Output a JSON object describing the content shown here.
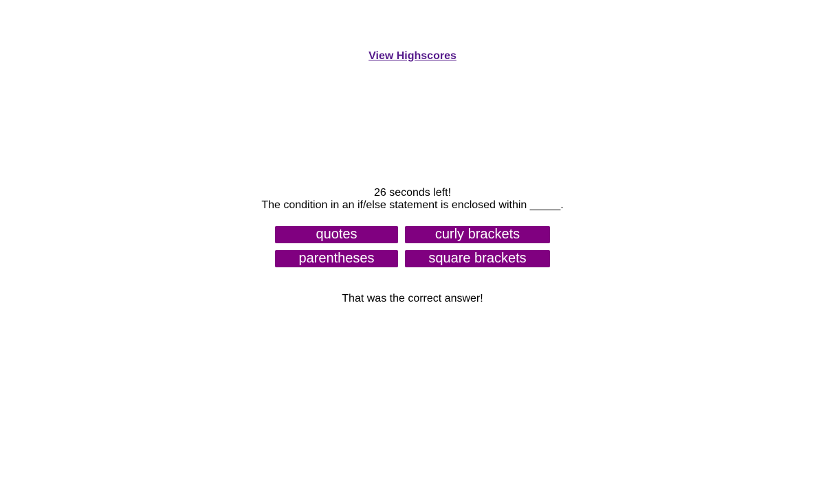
{
  "header": {
    "highscores_link": "View Highscores"
  },
  "quiz": {
    "timer_text": "26 seconds left!",
    "question": "The condition in an if/else statement is enclosed within _____.",
    "answers": [
      "quotes",
      "curly brackets",
      "parentheses",
      "square brackets"
    ],
    "feedback": "That was the correct answer!"
  },
  "colors": {
    "button_bg": "#800080",
    "button_text": "#ffffff",
    "link": "#551a8b"
  }
}
